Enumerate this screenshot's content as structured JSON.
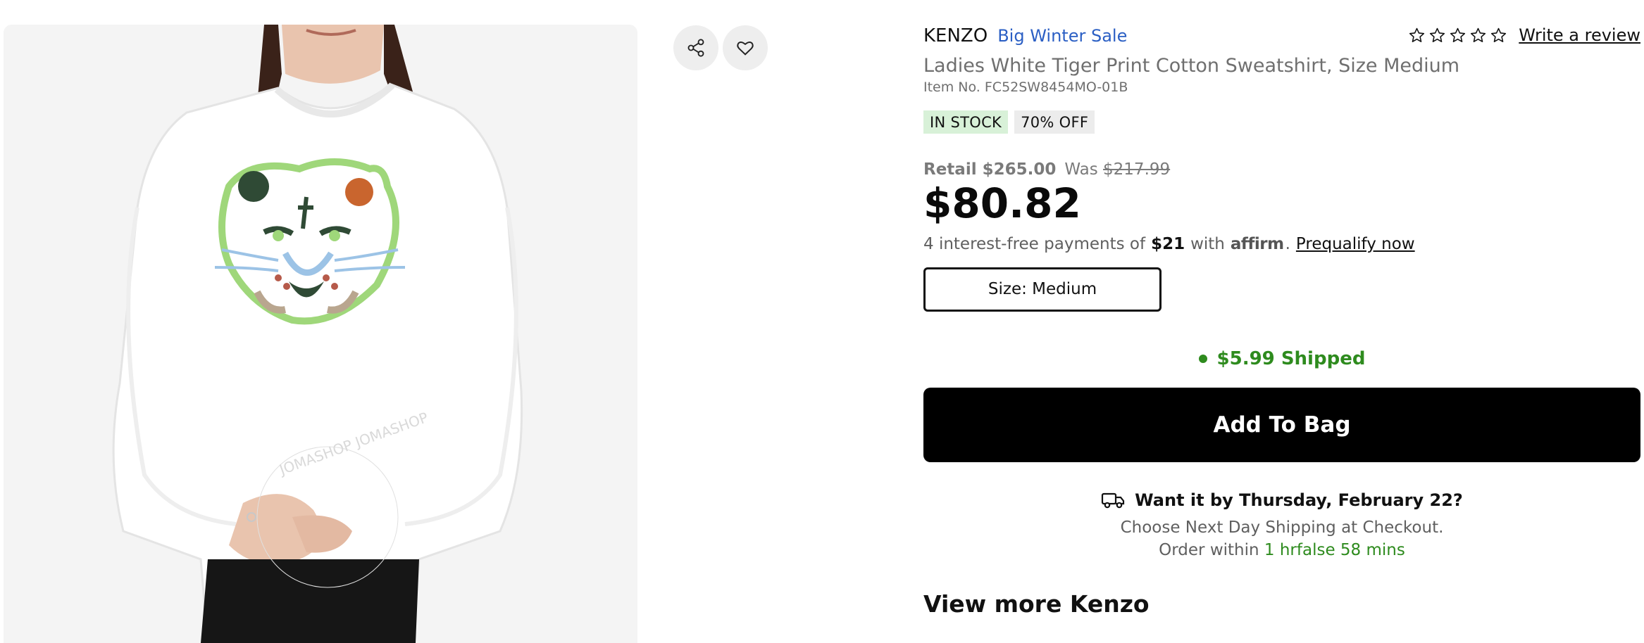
{
  "product": {
    "brand": "KENZO",
    "sale_label": "Big Winter Sale",
    "title": "Ladies White Tiger Print Cotton Sweatshirt, Size Medium",
    "item_no": "Item No. FC52SW8454MO-01B",
    "image_watermark": "JOMASHOP JOMASHOP"
  },
  "reviews": {
    "rating": 0,
    "max_rating": 5,
    "write_label": "Write a review"
  },
  "badges": {
    "stock": "IN STOCK",
    "discount": "70% OFF"
  },
  "pricing": {
    "retail": "Retail $265.00",
    "was_label": "Was",
    "was_value": "$217.99",
    "price": "$80.82"
  },
  "affirm": {
    "prefix": "4 interest-free payments of",
    "amount": "$21",
    "with": "with",
    "logo": "affirm",
    "period": ".",
    "prequalify": "Prequalify now"
  },
  "size": {
    "selected": "Size: Medium"
  },
  "shipping": {
    "label": "$5.99 Shipped"
  },
  "cart": {
    "add_label": "Add To Bag"
  },
  "delivery": {
    "headline": "Want it by Thursday, February 22?",
    "subline": "Choose Next Day Shipping at Checkout.",
    "order_within": "Order within",
    "countdown": "1 hrfalse 58 mins"
  },
  "links": {
    "view_more": "View more Kenzo"
  },
  "icons": {
    "share": "share-icon",
    "wishlist": "heart-icon",
    "star": "star-outline-icon",
    "truck": "truck-icon"
  },
  "colors": {
    "sale_blue": "#2b5fc4",
    "stock_bg": "#d8f1d8",
    "discount_bg": "#ececec",
    "shipping_green": "#2e8b1e",
    "countdown_green": "#2e8b1e"
  }
}
